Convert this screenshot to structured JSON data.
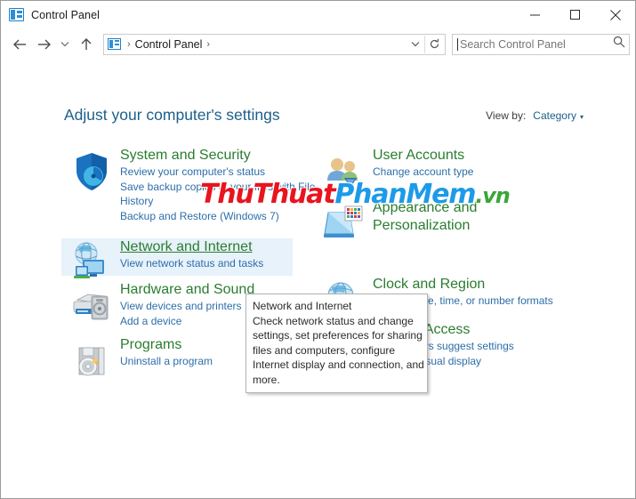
{
  "window": {
    "title": "Control Panel",
    "icon": "control-panel-icon",
    "minimize_label": "Minimize",
    "maximize_label": "Maximize",
    "close_label": "Close"
  },
  "navbar": {
    "back_label": "Back",
    "forward_label": "Forward",
    "recent_label": "Recent locations",
    "up_label": "Up",
    "breadcrumb": {
      "icon": "control-panel-icon",
      "sep1": "›",
      "item": "Control Panel",
      "sep2": "›",
      "dropdown": "⌄",
      "refresh": "↻"
    },
    "search": {
      "placeholder": "Search Control Panel",
      "icon": "search-icon"
    }
  },
  "content": {
    "page_title": "Adjust your computer's settings",
    "view_by": {
      "label": "View by:",
      "value": "Category",
      "arrow": "▾"
    },
    "categories_left": [
      {
        "title": "System and Security",
        "icon": "shield-icon",
        "links": [
          "Review your computer's status",
          "Save backup copies of your files with File History",
          "Backup and Restore (Windows 7)"
        ]
      },
      {
        "title": "Network and Internet",
        "icon": "network-globe-icon",
        "hovered": true,
        "links": [
          "View network status and tasks"
        ]
      },
      {
        "title": "Hardware and Sound",
        "icon": "printer-speaker-icon",
        "links": [
          "View devices and printers",
          "Add a device"
        ]
      },
      {
        "title": "Programs",
        "icon": "programs-disc-icon",
        "links": [
          "Uninstall a program"
        ]
      }
    ],
    "categories_right": [
      {
        "title": "User Accounts",
        "icon": "user-accounts-icon",
        "links": [
          "Change account type"
        ]
      },
      {
        "title": "Appearance and Personalization",
        "icon": "appearance-monitor-icon",
        "links": []
      },
      {
        "title": "Clock and Region",
        "icon": "clock-region-icon",
        "links": [
          "Change date, time, or number formats"
        ]
      },
      {
        "title": "Ease of Access",
        "icon": "ease-of-access-icon",
        "links": [
          "Let Windows suggest settings",
          "Optimize visual display"
        ]
      }
    ]
  },
  "tooltip": {
    "lines": [
      "Network and Internet",
      "Check network status and change",
      "settings, set preferences for sharing",
      "files and computers, configure",
      "Internet display and connection, and",
      "more."
    ]
  },
  "watermark": {
    "part1": "ThuThuat",
    "part2": "PhanMem",
    "part3": ".vn",
    "color1": "#e8141e",
    "color2": "#1d9ae8",
    "color3": "#3aa63a"
  }
}
